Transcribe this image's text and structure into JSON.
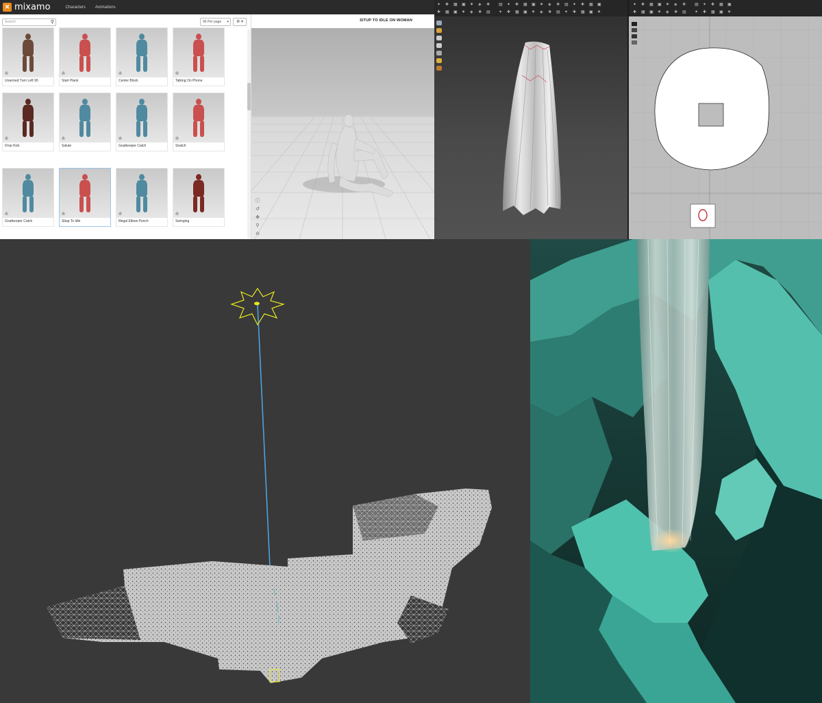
{
  "mixamo": {
    "logo_text": "mixamo",
    "logo_badge": "✕",
    "nav": [
      {
        "label": "Characters"
      },
      {
        "label": "Animations"
      }
    ],
    "search_placeholder": "Search",
    "per_page": "96 Per page",
    "gear_label": "⚙ ▾",
    "animation_title": "SITUP TO IDLE ON WOMAN",
    "cards": [
      {
        "label": "Unarmed Turn Left 90",
        "color": "#6b4a3a"
      },
      {
        "label": "Start Plank",
        "color": "#c9504f"
      },
      {
        "label": "Center Block",
        "color": "#4f8aa0"
      },
      {
        "label": "Talking On Phone",
        "color": "#c9504f"
      },
      {
        "label": "Drop Kick",
        "color": "#5a2a22"
      },
      {
        "label": "Salute",
        "color": "#4f8aa0"
      },
      {
        "label": "Goalkeeper Catch",
        "color": "#4f8aa0"
      },
      {
        "label": "Snatch",
        "color": "#c9504f"
      },
      {
        "label": "Goalkeeper Catch",
        "color": "#4f8aa0"
      },
      {
        "label": "Situp To Idle",
        "color": "#c9504f"
      },
      {
        "label": "Illegal Elbow Punch",
        "color": "#4f8aa0"
      },
      {
        "label": "Swinging",
        "color": "#7a2a22"
      }
    ],
    "selected_card": "Situp To Idle"
  },
  "colors": {
    "mixamo_orange": "#e8891e",
    "gizmo_yellow": "#e6e620",
    "gizmo_line_blue": "#4aa3df",
    "render_teal": "#4fc2ae"
  }
}
